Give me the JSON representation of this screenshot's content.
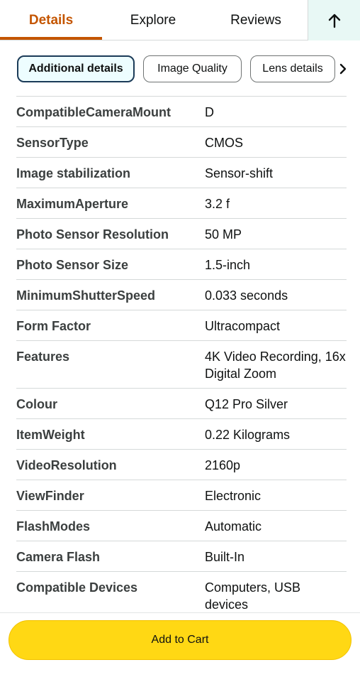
{
  "tabs": [
    {
      "label": "Details",
      "active": true
    },
    {
      "label": "Explore",
      "active": false
    },
    {
      "label": "Reviews",
      "active": false
    }
  ],
  "chips": [
    {
      "label": "Additional details",
      "selected": true
    },
    {
      "label": "Image Quality",
      "selected": false
    },
    {
      "label": "Lens details",
      "selected": false
    }
  ],
  "details": [
    {
      "key": "CompatibleCameraMount",
      "value": "D"
    },
    {
      "key": "SensorType",
      "value": "CMOS"
    },
    {
      "key": "Image stabilization",
      "value": "Sensor-shift"
    },
    {
      "key": "MaximumAperture",
      "value": "3.2 f"
    },
    {
      "key": "Photo Sensor Resolution",
      "value": "50 MP"
    },
    {
      "key": "Photo Sensor Size",
      "value": "1.5-inch"
    },
    {
      "key": "MinimumShutterSpeed",
      "value": "0.033 seconds"
    },
    {
      "key": "Form Factor",
      "value": "Ultracompact"
    },
    {
      "key": "Features",
      "value": "4K Video Recording, 16x Digital Zoom"
    },
    {
      "key": "Colour",
      "value": "Q12 Pro Silver"
    },
    {
      "key": "ItemWeight",
      "value": "0.22 Kilograms"
    },
    {
      "key": "VideoResolution",
      "value": "2160p"
    },
    {
      "key": "ViewFinder",
      "value": "Electronic"
    },
    {
      "key": "FlashModes",
      "value": "Automatic"
    },
    {
      "key": "Camera Flash",
      "value": "Built-In"
    },
    {
      "key": "Compatible Devices",
      "value": "Computers, USB devices"
    }
  ],
  "cart": {
    "label": "Add to Cart"
  },
  "colors": {
    "accent": "#c45500",
    "cart_button": "#ffd814",
    "scroll_top_bg": "#e8f8f5"
  }
}
